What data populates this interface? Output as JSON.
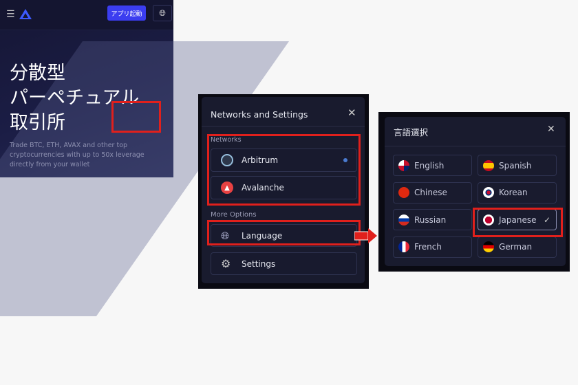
{
  "landing": {
    "launch_button": "アプリ起動",
    "title_lines": [
      "分散型",
      "パーペチュアル",
      "取引所"
    ],
    "subtitle_lines": [
      "Trade BTC, ETH, AVAX and other top",
      "cryptocurrencies with up to 50x leverage",
      "directly from your wallet"
    ]
  },
  "settings_modal": {
    "title": "Networks and Settings",
    "networks_label": "Networks",
    "networks": [
      {
        "label": "Arbitrum",
        "icon": "arbitrum-icon",
        "active": true
      },
      {
        "label": "Avalanche",
        "icon": "avalanche-icon",
        "active": false
      }
    ],
    "more_options_label": "More Options",
    "options": [
      {
        "label": "Language",
        "icon": "globe-icon"
      },
      {
        "label": "Settings",
        "icon": "gear-icon"
      }
    ]
  },
  "language_modal": {
    "title": "言語選択",
    "languages": [
      {
        "label": "English"
      },
      {
        "label": "Spanish"
      },
      {
        "label": "Chinese"
      },
      {
        "label": "Korean"
      },
      {
        "label": "Russian"
      },
      {
        "label": "Japanese",
        "selected": true
      },
      {
        "label": "French"
      },
      {
        "label": "German"
      }
    ]
  },
  "colors": {
    "highlight": "#e0201c",
    "accent": "#3b3df0",
    "panel": "#191b2e"
  }
}
